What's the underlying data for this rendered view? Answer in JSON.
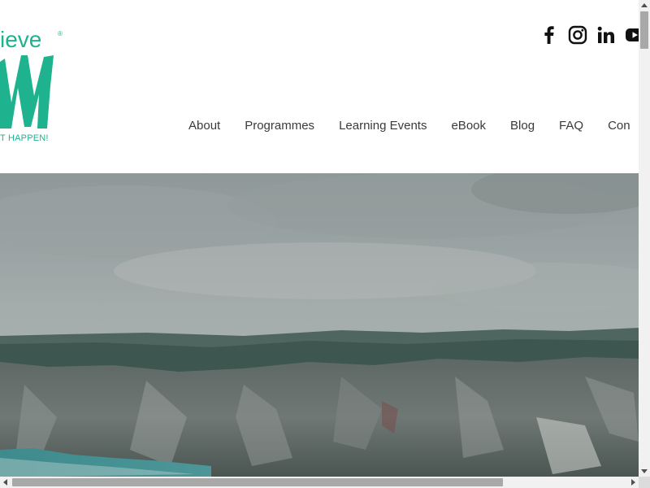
{
  "brand": {
    "logo_top_text": "ieve",
    "logo_registered": "®",
    "logo_tagline": "T HAPPEN!",
    "color": "#1fb28f"
  },
  "social": [
    {
      "name": "facebook-icon",
      "label": "Facebook"
    },
    {
      "name": "instagram-icon",
      "label": "Instagram"
    },
    {
      "name": "linkedin-icon",
      "label": "LinkedIn"
    },
    {
      "name": "youtube-icon",
      "label": "YouTube"
    }
  ],
  "nav": {
    "items": [
      "About",
      "Programmes",
      "Learning Events",
      "eBook",
      "Blog",
      "FAQ",
      "Con"
    ]
  },
  "hero": {
    "image": "coastal-cliffs-under-cloudy-sky"
  },
  "colors": {
    "nav_text": "#3a3a3a",
    "sky": "#9aa3a3",
    "sea": "#3e8a8d"
  }
}
